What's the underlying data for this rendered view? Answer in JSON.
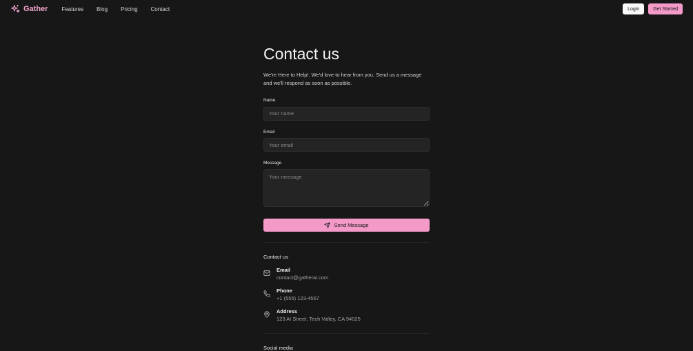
{
  "nav": {
    "brand": "Gather",
    "links": [
      "Features",
      "Blog",
      "Pricing",
      "Contact"
    ],
    "login": "Login",
    "get_started": "Get Started"
  },
  "colors": {
    "accent": "#f49ac9",
    "background": "#171717",
    "input_bg": "#242424"
  },
  "page": {
    "title": "Contact us",
    "intro": "We're Here to Help!. We'd love to hear from you. Send us a message and we'll respond as soon as possible."
  },
  "form": {
    "name_label": "Name",
    "name_placeholder": "Your name",
    "email_label": "Email",
    "email_placeholder": "Your email",
    "message_label": "Message",
    "message_placeholder": "Your message",
    "send_label": "Send Message",
    "send_icon": "send-icon"
  },
  "contact": {
    "title": "Contact us",
    "items": [
      {
        "icon": "mail-icon",
        "label": "Email",
        "value": "contact@gatherai.com"
      },
      {
        "icon": "phone-icon",
        "label": "Phone",
        "value": "+1 (555) 123-4567"
      },
      {
        "icon": "map-pin-icon",
        "label": "Address",
        "value": "123 AI Street, Tech Valley, CA 94025"
      }
    ]
  },
  "social": {
    "title": "Social media"
  }
}
